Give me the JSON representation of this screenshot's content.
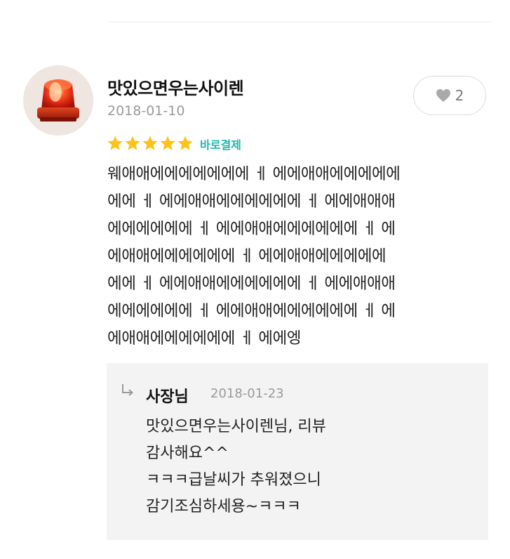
{
  "review": {
    "username": "맛있으면우는사이렌",
    "date": "2018-01-10",
    "likes": "2",
    "rating": 5,
    "badge": "바로결제",
    "text_lines": [
      "웨애애에에에에에에에 ㅔ 에에애애에에에에에",
      "에에 ㅔ 에에애애에에에에에에 ㅔ 에에애애애",
      "에에에에에에 ㅔ 에에애애에에에에에에 ㅔ 에",
      "에애애에에에에에에 ㅔ 에에애애에에에에에",
      "에에 ㅔ 에에애애에에에에에에 ㅔ 에에애애애",
      "에에에에에에 ㅔ 에에애애에에에에에에 ㅔ 에",
      "에애애에에에에에에 ㅔ 에에엥"
    ]
  },
  "reply": {
    "author": "사장님",
    "date": "2018-01-23",
    "text_lines": [
      "맛있으면우는사이렌님, 리뷰",
      "감사해요^^",
      "ㅋㅋㅋ급날씨가 추워졌으니",
      "감기조심하세용~ㅋㅋㅋ"
    ]
  },
  "colors": {
    "star": "#ffc21a",
    "badge": "#1fb8ad",
    "reply_background": "#f3f3f4",
    "muted_text": "#9a9a9a"
  },
  "icons": {
    "avatar": "red-siren-light",
    "like": "heart-icon",
    "star": "star-icon",
    "reply": "reply-arrow-icon"
  }
}
